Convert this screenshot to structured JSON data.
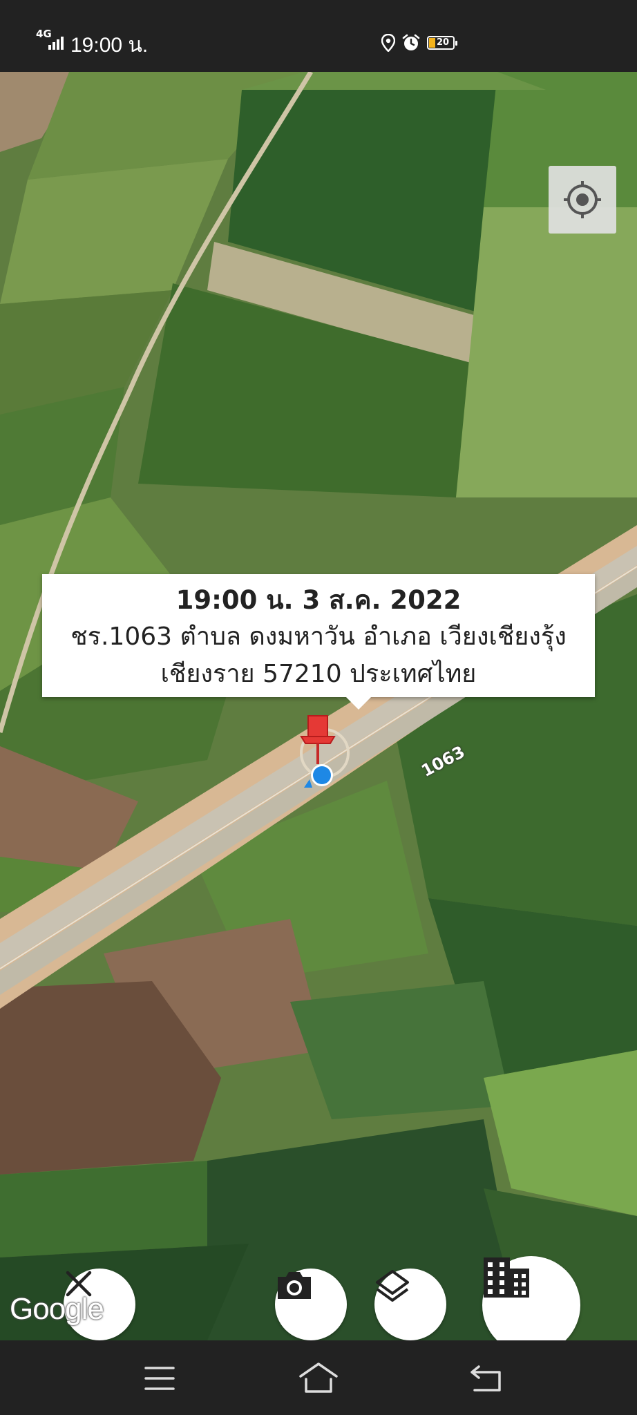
{
  "status_bar": {
    "network": "4G",
    "time": "19:00 น.",
    "battery_level": "20",
    "icons": [
      "signal-icon",
      "location-icon",
      "alarm-icon",
      "battery-icon"
    ]
  },
  "map": {
    "road_label": "1063",
    "attribution": "Google"
  },
  "callout": {
    "datetime": "19:00 น. 3 ส.ค. 2022",
    "address_line1": "ชร.1063 ตำบล ดงมหาวัน อำเภอ เวียงเชียงรุ้ง",
    "address_line2": "เชียงราย 57210 ประเทศไทย"
  },
  "buttons": {
    "locate": "my-location-icon",
    "close": "close-icon",
    "camera": "camera-icon",
    "layers": "layers-icon",
    "building": "building-icon"
  },
  "nav": [
    "menu-icon",
    "home-icon",
    "back-icon"
  ],
  "colors": {
    "marker_red": "#e53935",
    "location_blue": "#1e88e5",
    "bar_background": "#222222",
    "battery_fill": "#f2b21b"
  }
}
